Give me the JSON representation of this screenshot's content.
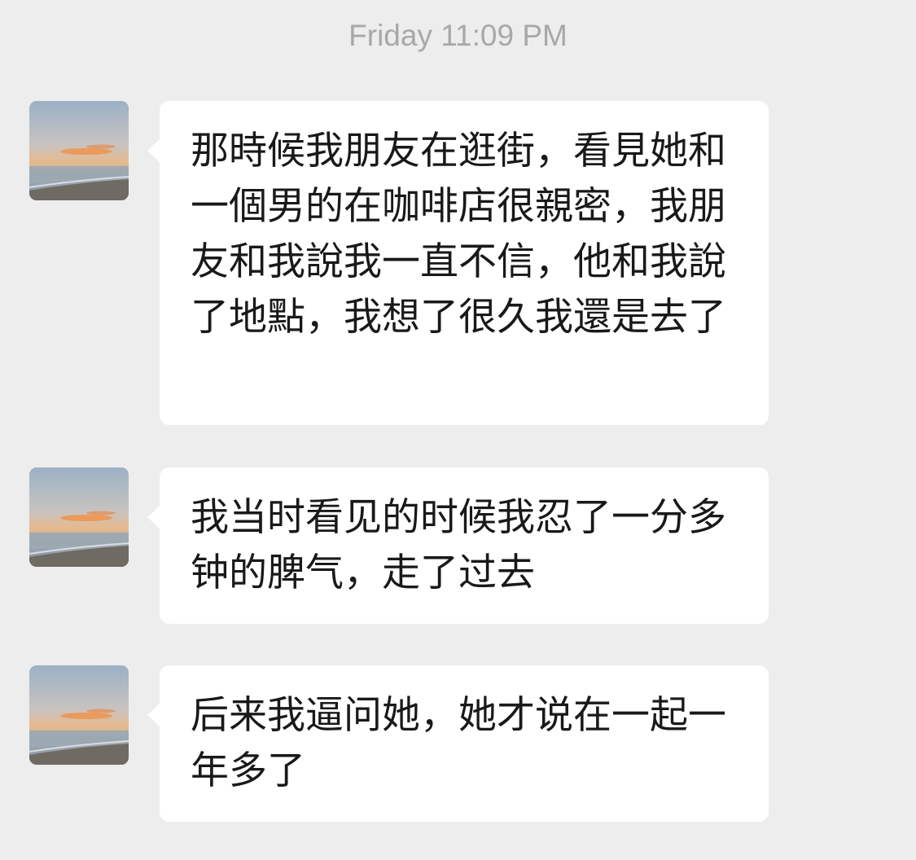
{
  "timestamp": "Friday 11:09 PM",
  "messages": [
    {
      "avatar": "sunset-beach-avatar",
      "text": "那時候我朋友在逛街，看見她和一個男的在咖啡店很親密，我朋友和我說我一直不信，他和我說了地點，我想了很久我還是去了"
    },
    {
      "avatar": "sunset-beach-avatar",
      "text": "我当时看见的时候我忍了一分多钟的脾气，走了过去"
    },
    {
      "avatar": "sunset-beach-avatar",
      "text": "后来我逼问她，她才说在一起一年多了"
    }
  ]
}
